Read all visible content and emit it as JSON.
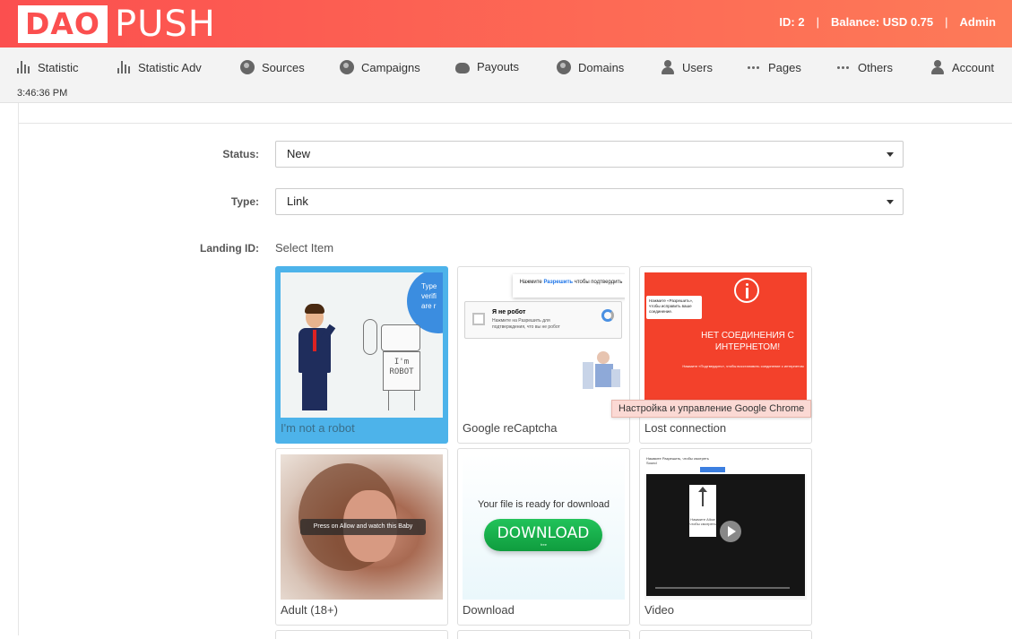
{
  "header": {
    "logo_left": "DAO",
    "logo_right": "PUSH",
    "id_text": "ID: 2",
    "balance_text": "Balance: USD 0.75",
    "user_text": "Admin",
    "separator": "|"
  },
  "nav": {
    "items": [
      {
        "label": "Statistic",
        "icon": "bars-icon"
      },
      {
        "label": "Statistic Adv",
        "icon": "bars-icon"
      },
      {
        "label": "Sources",
        "icon": "globe-icon"
      },
      {
        "label": "Campaigns",
        "icon": "globe-icon"
      },
      {
        "label": "Payouts",
        "icon": "piggy-bank-icon"
      },
      {
        "label": "Domains",
        "icon": "globe-icon"
      },
      {
        "label": "Users",
        "icon": "user-icon"
      },
      {
        "label": "Pages",
        "icon": "dots-icon"
      },
      {
        "label": "Others",
        "icon": "dots-icon"
      },
      {
        "label": "Account",
        "icon": "user-icon"
      }
    ],
    "time": "3:46:36 PM"
  },
  "form": {
    "status_label": "Status:",
    "status_value": "New",
    "type_label": "Type:",
    "type_value": "Link",
    "landing_label": "Landing ID:",
    "landing_placeholder": "Select Item"
  },
  "landings": [
    {
      "caption": "I'm not a robot",
      "selected": true,
      "bubble_text": "Type verifi are r",
      "robot_text": "I'm ROBOT"
    },
    {
      "caption": "Google reCaptcha",
      "selected": false,
      "popup_text_a": "Нажмите",
      "popup_text_b": "Разрешить",
      "popup_text_c": "чтобы подтвердить",
      "captcha_title": "Я не робот",
      "captcha_sub": "Нажмите на Разрешить для подтверждения, что вы не робот",
      "captcha_privacy": "Privacy - Terms"
    },
    {
      "caption": "Lost connection",
      "selected": false,
      "popup_text": "Нажмите «Разрешить», чтобы исправить ваше соединение.",
      "headline": "НЕТ СОЕДИНЕНИЯ С ИНТЕРНЕТОМ!",
      "subline": "Нажмите «Подтвердить», чтобы восстановить соединение с интернетом"
    },
    {
      "caption": "Adult (18+)",
      "selected": false,
      "overlay_text": "Press on Allow and watch this Baby"
    },
    {
      "caption": "Download",
      "selected": false,
      "ready_text": "Your file is ready for download",
      "button_text": "DOWNLOAD",
      "free_text": "free"
    },
    {
      "caption": "Video",
      "selected": false,
      "browser_text": "Нажмите Разрешить, чтобы смотреть",
      "tab_text": "Sound",
      "popup_text": "Нажмите Allow чтобы смотреть"
    }
  ],
  "tooltip": "Настройка и управление Google Chrome",
  "colors": {
    "header_red": "#fb4f4f",
    "selected_blue": "#4db3ea",
    "download_green": "#1aad4b"
  }
}
